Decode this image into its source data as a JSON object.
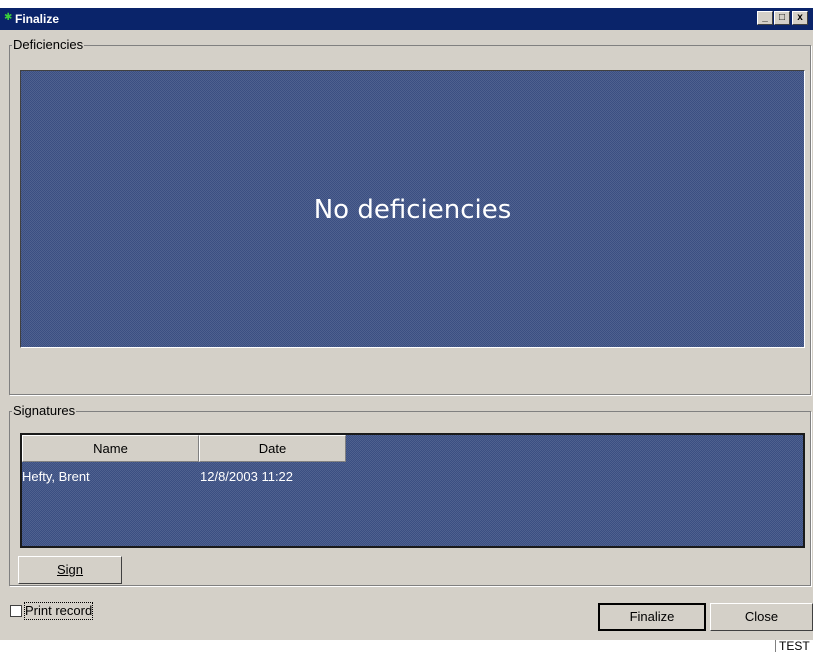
{
  "window": {
    "title": "Finalize",
    "controls": {
      "minimize": "_",
      "maximize": "□",
      "close": "x"
    }
  },
  "deficiencies": {
    "group_label": "Deficiencies",
    "message": "No deficiencies"
  },
  "signatures": {
    "group_label": "Signatures",
    "columns": [
      "Name",
      "Date"
    ],
    "rows": [
      {
        "name": "Hefty, Brent",
        "date": "12/8/2003 11:22"
      }
    ]
  },
  "buttons": {
    "sign": "Sign",
    "finalize": "Finalize",
    "close": "Close"
  },
  "print_record": {
    "label": "Print record",
    "checked": false
  },
  "status": {
    "text": "TEST"
  },
  "colors": {
    "titlebar": "#0a246a",
    "panel": "#3b4f82",
    "face": "#d4d0c8"
  }
}
